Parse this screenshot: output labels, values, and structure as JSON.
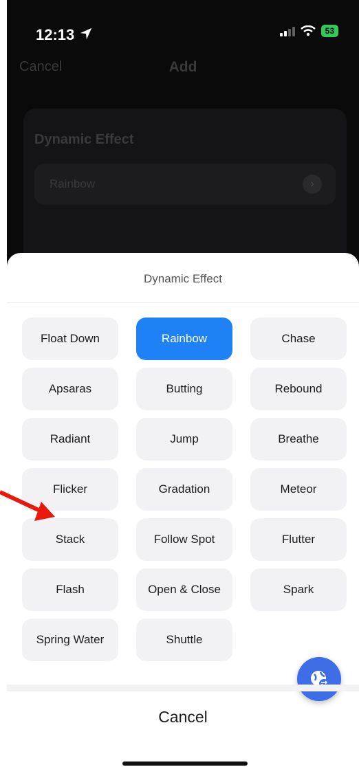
{
  "status_bar": {
    "time": "12:13",
    "battery": "53"
  },
  "nav": {
    "cancel": "Cancel",
    "title": "Add"
  },
  "background_card": {
    "label": "Dynamic Effect",
    "value": "Rainbow"
  },
  "sheet": {
    "title": "Dynamic Effect",
    "selected": "Rainbow",
    "options": [
      [
        "Float Down",
        "Rainbow",
        "Chase"
      ],
      [
        "Apsaras",
        "Butting",
        "Rebound"
      ],
      [
        "Radiant",
        "Jump",
        "Breathe"
      ],
      [
        "Flicker",
        "Gradation",
        "Meteor"
      ],
      [
        "Stack",
        "Follow Spot",
        "Flutter"
      ],
      [
        "Flash",
        "Open & Close",
        "Spark"
      ],
      [
        "Spring Water",
        "Shuttle"
      ]
    ],
    "cancel": "Cancel"
  },
  "colors": {
    "accent": "#1e82f6",
    "annotation_arrow": "#e8180c"
  },
  "icons": {
    "location": "location-arrow-icon",
    "fab": "globe-swap-icon"
  }
}
